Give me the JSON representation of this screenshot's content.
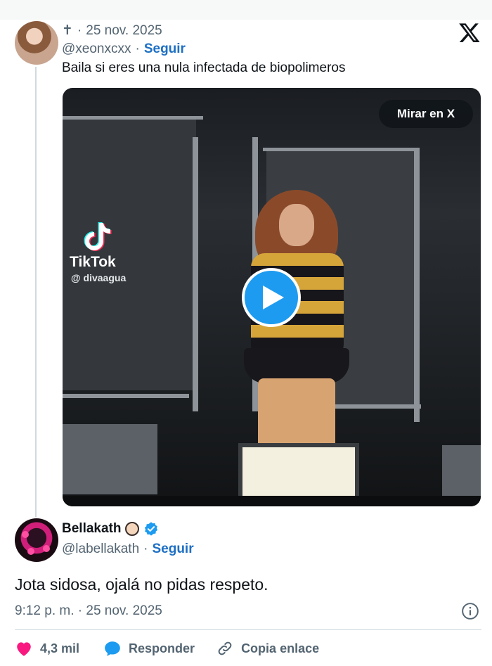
{
  "quoted_tweet": {
    "display_name": "✝",
    "date": "25 nov. 2025",
    "handle": "@xeonxcxx",
    "follow_label": "Seguir",
    "text": "Baila si eres una nula infectada de biopolimeros",
    "media": {
      "watch_label": "Mirar en X",
      "watermark_brand": "TikTok",
      "watermark_user": "@ divaagua"
    }
  },
  "reply": {
    "display_name": "Bellakath",
    "handle": "@labellakath",
    "follow_label": "Seguir",
    "text": "Jota sidosa, ojalá no pidas respeto.",
    "timestamp": "9:12 p. m. · 25 nov. 2025",
    "actions": {
      "likes": "4,3 mil",
      "reply_label": "Responder",
      "copy_link_label": "Copia enlace"
    }
  },
  "colors": {
    "accent": "#1d9bf0",
    "follow": "#1d6fc4",
    "like": "#f91880",
    "secondary_text": "#536471"
  },
  "icons": [
    "x-logo-icon",
    "verified-badge-icon",
    "play-icon",
    "tiktok-icon",
    "heart-icon",
    "reply-bubble-icon",
    "link-icon",
    "info-icon"
  ]
}
